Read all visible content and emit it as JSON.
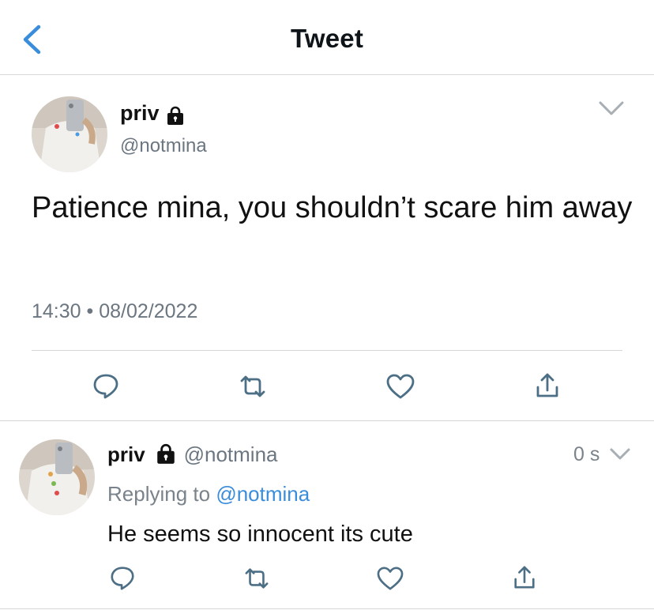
{
  "header": {
    "title": "Tweet"
  },
  "main_tweet": {
    "display_name": "priv",
    "handle": "@notmina",
    "text": "Patience mina, you shouldn’t scare him away",
    "time": "14:30",
    "dot": "•",
    "date": "08/02/2022"
  },
  "reply_tweet": {
    "display_name": "priv",
    "handle": "@notmina",
    "age": "0 s",
    "replying_prefix": "Replying to",
    "replying_to": "@notmina",
    "text": "He seems so innocent its cute"
  },
  "colors": {
    "accent": "#3a8ddb",
    "muted": "#6b7680",
    "divider": "#d6d6d6",
    "icon": "#4d6f86"
  },
  "icons": [
    "chevron-left-icon",
    "lock-icon",
    "chevron-down-icon",
    "comment-icon",
    "retweet-icon",
    "heart-icon",
    "share-icon"
  ]
}
